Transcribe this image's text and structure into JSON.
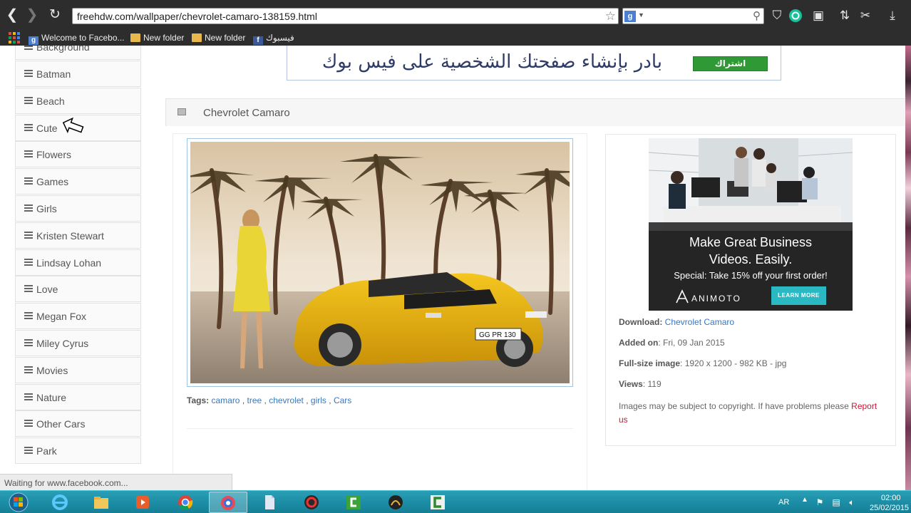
{
  "browser": {
    "url": "freehdw.com/wallpaper/chevrolet-camaro-138159.html",
    "bookmarks": [
      {
        "label": "Welcome to Facebo...",
        "icon": "google-icon"
      },
      {
        "label": "New folder",
        "icon": "folder-icon"
      },
      {
        "label": "New folder",
        "icon": "folder-icon"
      },
      {
        "label": "فيسبوك",
        "icon": "facebook-icon"
      }
    ],
    "status": "Waiting for www.facebook.com..."
  },
  "sidebar": {
    "partial_item": "Background",
    "items": [
      {
        "label": "Batman"
      },
      {
        "label": "Beach"
      },
      {
        "label": "Cute"
      },
      {
        "label": "Flowers"
      },
      {
        "label": "Games"
      },
      {
        "label": "Girls"
      },
      {
        "label": "Kristen Stewart"
      },
      {
        "label": "Lindsay Lohan"
      },
      {
        "label": "Love"
      },
      {
        "label": "Megan Fox"
      },
      {
        "label": "Miley Cyrus"
      },
      {
        "label": "Movies"
      },
      {
        "label": "Nature"
      },
      {
        "label": "Other Cars"
      },
      {
        "label": "Park"
      }
    ]
  },
  "banner": {
    "text": "بادر بإنشاء صفحتك الشخصية على فيس بوك",
    "button": "اشتراك"
  },
  "panel": {
    "title": "Chevrolet Camaro"
  },
  "tags": {
    "label": "Tags:",
    "items": [
      "camaro",
      "tree",
      "chevrolet",
      "girls",
      "Cars"
    ],
    "separator": " , "
  },
  "ad": {
    "headline_1": "Make Great Business",
    "headline_2": "Videos. Easily.",
    "special": "Special: Take 15% off your first order!",
    "brand": "ANIMOTO",
    "button": "LEARN MORE"
  },
  "details": {
    "download_label": "Download:",
    "download_value": "Chevrolet Camaro",
    "added_label": "Added on",
    "added_value": ": Fri, 09 Jan 2015",
    "fullsize_label": "Full-size image",
    "fullsize_value": ": 1920 x 1200 - 982 KB - jpg",
    "views_label": "Views",
    "views_value": ": 119",
    "copyright_text": "Images may be subject to copyright. If have problems please ",
    "report_link": "Report us"
  },
  "taskbar": {
    "lang": "AR",
    "time": "02:00",
    "date": "25/02/2015"
  },
  "colors": {
    "link": "#3a78bd",
    "report": "#c8163a",
    "banner_button": "#2f9a35",
    "ad_button": "#2ab8c3",
    "taskbar": "#1c8ea6"
  }
}
